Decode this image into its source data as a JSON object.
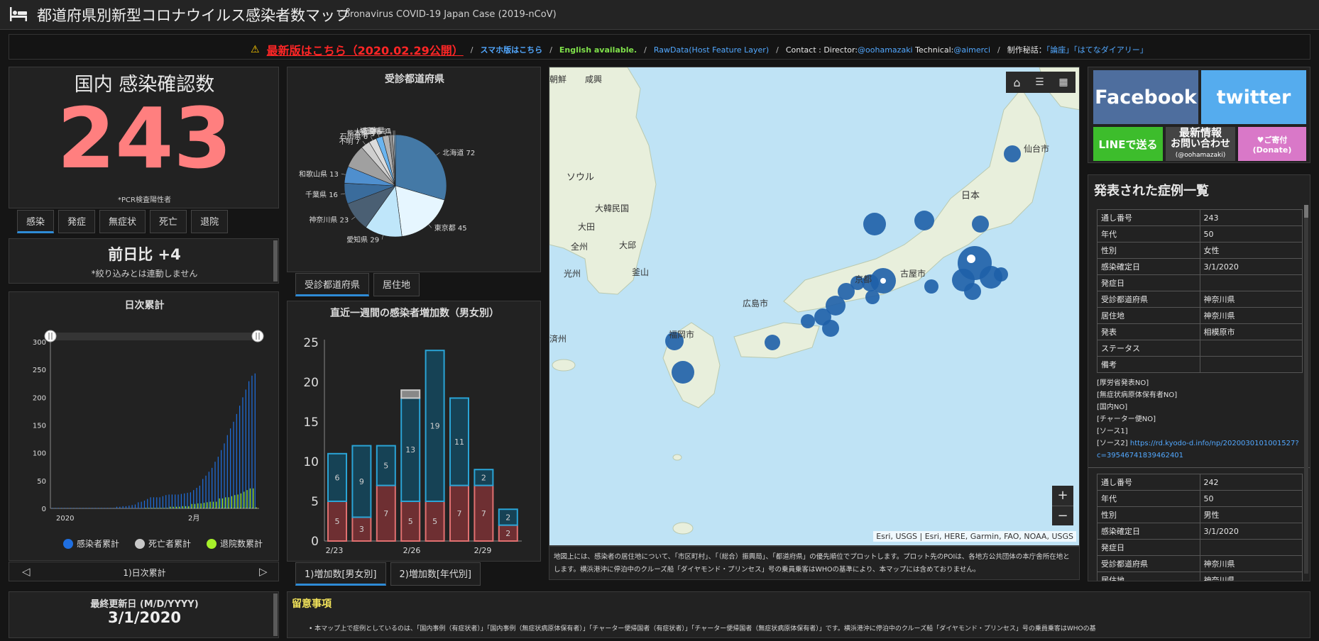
{
  "header": {
    "title": "都道府県別新型コロナウイルス感染者数マップ",
    "subtitle": "Coronavirus COVID-19 Japan Case (2019-nCoV)"
  },
  "linkbar": {
    "warning": "最新版はこちら（2020.02.29公開）",
    "mobile": "スマホ版はこちら",
    "english": "English available.",
    "rawdata": "RawData(Host Feature Layer)",
    "contact_prefix": "Contact : Director:",
    "director": "@oohamazaki",
    "technical_prefix": "Technical:",
    "technical": "@aimerci",
    "making_prefix": "制作秘話：",
    "making_link1": "「論座」",
    "making_link2": "「はてなダイアリー」",
    "sep": "/"
  },
  "total": {
    "title": "国内 感染確認数",
    "value": "243",
    "note": "*PCR検査陽性者",
    "color": "#ff7f7f"
  },
  "total_tabs": [
    "感染",
    "発症",
    "無症状",
    "死亡",
    "退院"
  ],
  "daydiff": {
    "label": "前日比 +4",
    "note": "*絞り込みとは連動しません"
  },
  "cumulative": {
    "title": "日次累計",
    "nav_label": "1)日次累計"
  },
  "pie_tabs": [
    "受診都道府県",
    "居住地"
  ],
  "weekly_tabs": [
    "1)増加数[男女別]",
    "2)増加数[年代別]"
  ],
  "map": {
    "labels": {
      "korea_north": "朝鮮",
      "hamgyong": "咸興",
      "seoul": "ソウル",
      "korea": "大韓民国",
      "daejeon": "大田",
      "daegu": "大邱",
      "jeonju": "全州",
      "gwangju": "光州",
      "busan": "釜山",
      "jeju": "済州",
      "fukuoka": "福岡市",
      "hiroshima": "広島市",
      "kyoto": "京都",
      "nagoya": "古屋市",
      "japan": "日本",
      "sendai": "仙台市"
    },
    "attribution": "Esri, USGS | Esri, HERE, Garmin, FAO, NOAA, USGS",
    "zoom_in": "+",
    "zoom_out": "−",
    "caption": "地図上には、感染者の居住地について、「市区町村」、「（総合）振興局」、「都道府県」の優先順位でプロットします。プロット先のPOIは、各地方公共団体の本庁舎所在地とします。横浜港沖に停泊中のクルーズ船「ダイヤモンド・プリンセス」号の乗員乗客はWHOの基準により、本マップには含めておりません。",
    "bubble_color": "#1e5fa8",
    "land_color": "#e8efdc",
    "sea_color": "#bfe3f5"
  },
  "social": {
    "facebook": "Facebook",
    "twitter": "twitter",
    "line": "LINEで送る",
    "news_l1": "最新情報",
    "news_l2": "お問い合わせ",
    "news_l3": "(@oohamazaki)",
    "donate": "♥ご寄付 (Donate)"
  },
  "cases": {
    "title": "発表された症例一覧",
    "records": [
      {
        "rows": [
          [
            "通し番号",
            "243"
          ],
          [
            "年代",
            "50"
          ],
          [
            "性別",
            "女性"
          ],
          [
            "感染確定日",
            "3/1/2020"
          ],
          [
            "発症日",
            ""
          ],
          [
            "受診都道府県",
            "神奈川県"
          ],
          [
            "居住地",
            "神奈川県"
          ],
          [
            "発表",
            "相模原市"
          ],
          [
            "ステータス",
            ""
          ],
          [
            "備考",
            ""
          ]
        ],
        "notes": [
          "[厚労省発表NO]",
          "[無症状病原体保有者NO]",
          "[国内NO]",
          "[チャーター便NO]",
          "[ソース1]"
        ],
        "source2_label": "[ソース2]",
        "source2_url_l1": "https://rd.kyodo-d.info/np/2020030101001527?",
        "source2_url_l2": "c=39546741839462401"
      },
      {
        "rows": [
          [
            "通し番号",
            "242"
          ],
          [
            "年代",
            "50"
          ],
          [
            "性別",
            "男性"
          ],
          [
            "感染確定日",
            "3/1/2020"
          ],
          [
            "発症日",
            ""
          ],
          [
            "受診都道府県",
            "神奈川県"
          ],
          [
            "居住地",
            "神奈川県"
          ]
        ]
      }
    ]
  },
  "update": {
    "title": "最終更新日 (M/D/YYYY)",
    "date": "3/1/2020"
  },
  "notice": {
    "title": "留意事項",
    "text": "本マップ上で症例としているのは、「国内事例（有症状者）」「国内事例（無症状病原体保有者）」「チャーター便帰国者（有症状者）」「チャーター便帰国者（無症状病原体保有者）」です。横浜港沖に停泊中のクルーズ船「ダイヤモンド・プリンセス」号の乗員乗客はWHOの基"
  },
  "chart_data": [
    {
      "type": "pie",
      "title": "受診都道府県",
      "labels": [
        "北海道",
        "東京都",
        "愛知県",
        "神奈川県",
        "千葉県",
        "和歌山県",
        "不明",
        "石川県",
        "熊本県",
        "大阪府",
        "埼玉県",
        "三重県",
        "栃木県"
      ],
      "values": [
        72,
        45,
        29,
        23,
        16,
        13,
        7,
        6,
        5,
        5,
        3,
        1,
        1
      ],
      "slice_labels": [
        "北海道 72",
        "東京都 45",
        "愛知県 29",
        "神奈川県 23",
        "千葉県 16",
        "和歌山県 13",
        "不明 7",
        "石川県 6",
        "熊本県 5",
        "大阪府 5",
        "埼玉県 3",
        "三重県 1",
        "栃木県 1"
      ],
      "other_total": 18,
      "colors": [
        "#4479a6",
        "#e6f6ff",
        "#bfe6fa",
        "#4a5f73",
        "#3a6c9c",
        "#4f8fce",
        "#cfcfcf",
        "#dcdcdc",
        "#6ab4ef",
        "#b3b3b3",
        "#8a8a8a",
        "#f0f0f0",
        "#9dc9ea"
      ],
      "other_color": "#a0a0a0"
    },
    {
      "type": "area",
      "title": "日次累計",
      "x_tick_labels": [
        "2020",
        "2月"
      ],
      "y_ticks": [
        0,
        50,
        100,
        150,
        200,
        250,
        300
      ],
      "ylim": [
        0,
        300
      ],
      "series": [
        {
          "name": "感染者累計",
          "color": "#1f6fe0",
          "values": [
            1,
            1,
            1,
            1,
            1,
            1,
            1,
            1,
            1,
            1,
            1,
            1,
            1,
            1,
            1,
            1,
            1,
            1,
            1,
            1,
            1,
            3,
            3,
            4,
            4,
            5,
            6,
            7,
            11,
            12,
            14,
            17,
            20,
            20,
            20,
            20,
            22,
            24,
            25,
            25,
            25,
            25,
            26,
            27,
            28,
            29,
            33,
            37,
            41,
            53,
            59,
            66,
            73,
            84,
            93,
            105,
            117,
            132,
            144,
            156,
            170,
            185,
            200,
            214,
            229,
            239,
            243
          ]
        },
        {
          "name": "死亡者累計",
          "color": "#c8c8c8",
          "values": [
            0,
            0,
            0,
            0,
            0,
            0,
            0,
            0,
            0,
            0,
            0,
            0,
            0,
            0,
            0,
            0,
            0,
            0,
            0,
            0,
            0,
            0,
            0,
            0,
            0,
            0,
            0,
            0,
            0,
            0,
            0,
            0,
            0,
            0,
            0,
            0,
            0,
            0,
            0,
            0,
            0,
            0,
            0,
            0,
            1,
            1,
            1,
            1,
            1,
            1,
            1,
            1,
            1,
            1,
            1,
            1,
            1,
            1,
            1,
            1,
            1,
            1,
            1,
            1,
            1,
            1,
            1
          ]
        },
        {
          "name": "退院数累計",
          "color": "#a6f02a",
          "values": [
            0,
            0,
            0,
            0,
            0,
            0,
            0,
            0,
            0,
            0,
            0,
            0,
            0,
            0,
            0,
            0,
            0,
            0,
            0,
            0,
            0,
            0,
            0,
            0,
            0,
            0,
            0,
            0,
            0,
            0,
            1,
            1,
            1,
            1,
            1,
            1,
            1,
            1,
            3,
            3,
            3,
            3,
            4,
            4,
            4,
            8,
            8,
            9,
            9,
            10,
            11,
            12,
            12,
            12,
            18,
            18,
            20,
            20,
            22,
            24,
            25,
            27,
            30,
            33,
            36,
            36,
            2
          ]
        }
      ]
    },
    {
      "type": "bar",
      "title": "直近一週間の感染者増加数（男女別）",
      "x_tick_labels": [
        "2/23",
        "2/26",
        "2/29"
      ],
      "y_ticks": [
        0,
        5,
        10,
        15,
        20,
        25
      ],
      "ylim": [
        0,
        25
      ],
      "series": [
        {
          "name": "",
          "color": "#6e2f32",
          "stroke": "#e07070",
          "values": [
            5,
            3,
            7,
            5,
            5,
            7,
            7,
            2
          ]
        },
        {
          "name": "",
          "color": "#164255",
          "stroke": "#2aa4d6",
          "values": [
            6,
            9,
            5,
            13,
            19,
            11,
            2,
            2
          ]
        },
        {
          "name": "",
          "color": "#888888",
          "stroke": "#cccccc",
          "values": [
            0,
            0,
            0,
            1,
            0,
            0,
            0,
            0
          ]
        }
      ]
    }
  ]
}
